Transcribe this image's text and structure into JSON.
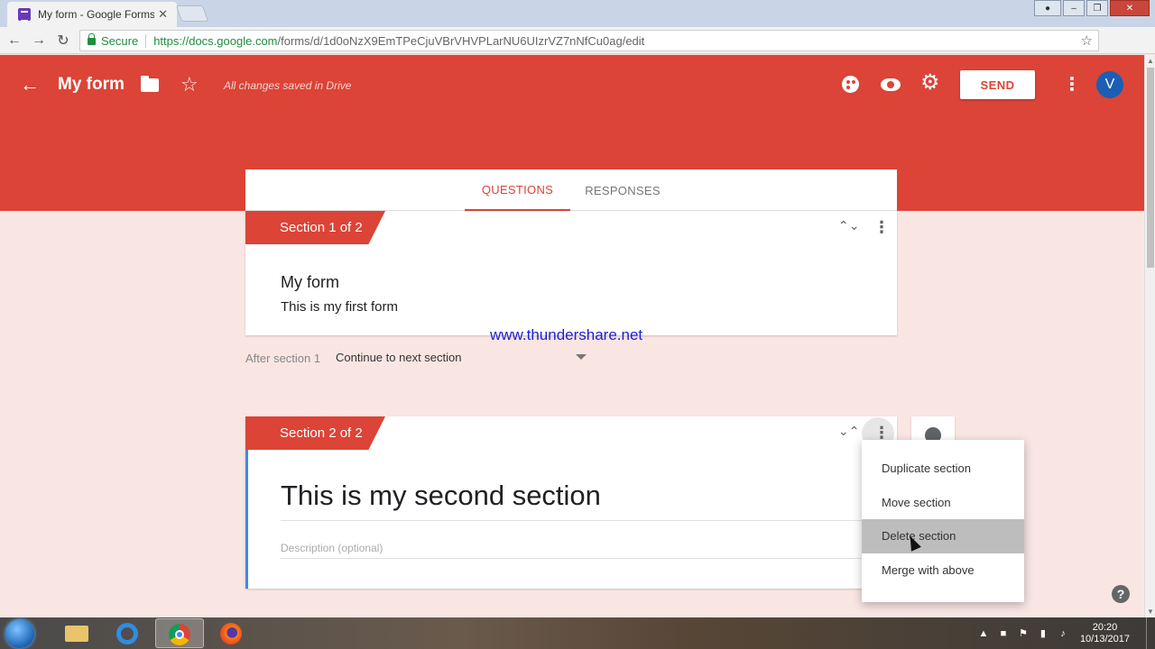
{
  "browser": {
    "tab_title": "My form - Google Forms",
    "tab_close": "✕",
    "secure_label": "Secure",
    "url_host": "https://docs.google.com",
    "url_path": "/forms/d/1d0oNzX9EmTPeCjuVBrVHVPLarNU6UIzrVZ7nNfCu0ag/edit",
    "back": "←",
    "forward": "→",
    "reload": "↻",
    "bookmark_star": "☆",
    "menu": "⋮"
  },
  "header": {
    "back": "←",
    "title": "My form",
    "star": "☆",
    "saved_status": "All changes saved in Drive",
    "gear": "⚙",
    "send_label": "SEND",
    "more": "⋮",
    "avatar_letter": "V",
    "brand_color": "#db4437"
  },
  "tabs": [
    {
      "label": "QUESTIONS"
    },
    {
      "label": "RESPONSES"
    }
  ],
  "section1": {
    "badge": "Section 1 of 2",
    "collapse": "⌃⌄",
    "more": "⋮",
    "title": "My form",
    "description": "This is my first form"
  },
  "after_section": {
    "label": "After section 1",
    "value": "Continue to next section"
  },
  "section2": {
    "badge": "Section 2 of 2",
    "collapse": "⌄⌃",
    "more": "⋮",
    "title": "This is my second section",
    "description_placeholder": "Description (optional)"
  },
  "context_menu": {
    "items": [
      {
        "label": "Duplicate section"
      },
      {
        "label": "Move section"
      },
      {
        "label": "Delete section"
      },
      {
        "label": "Merge with above"
      }
    ]
  },
  "watermark": "www.thundershare.net",
  "help": "?",
  "taskbar": {
    "time": "20:20",
    "date": "10/13/2017",
    "tray_up": "▲"
  }
}
